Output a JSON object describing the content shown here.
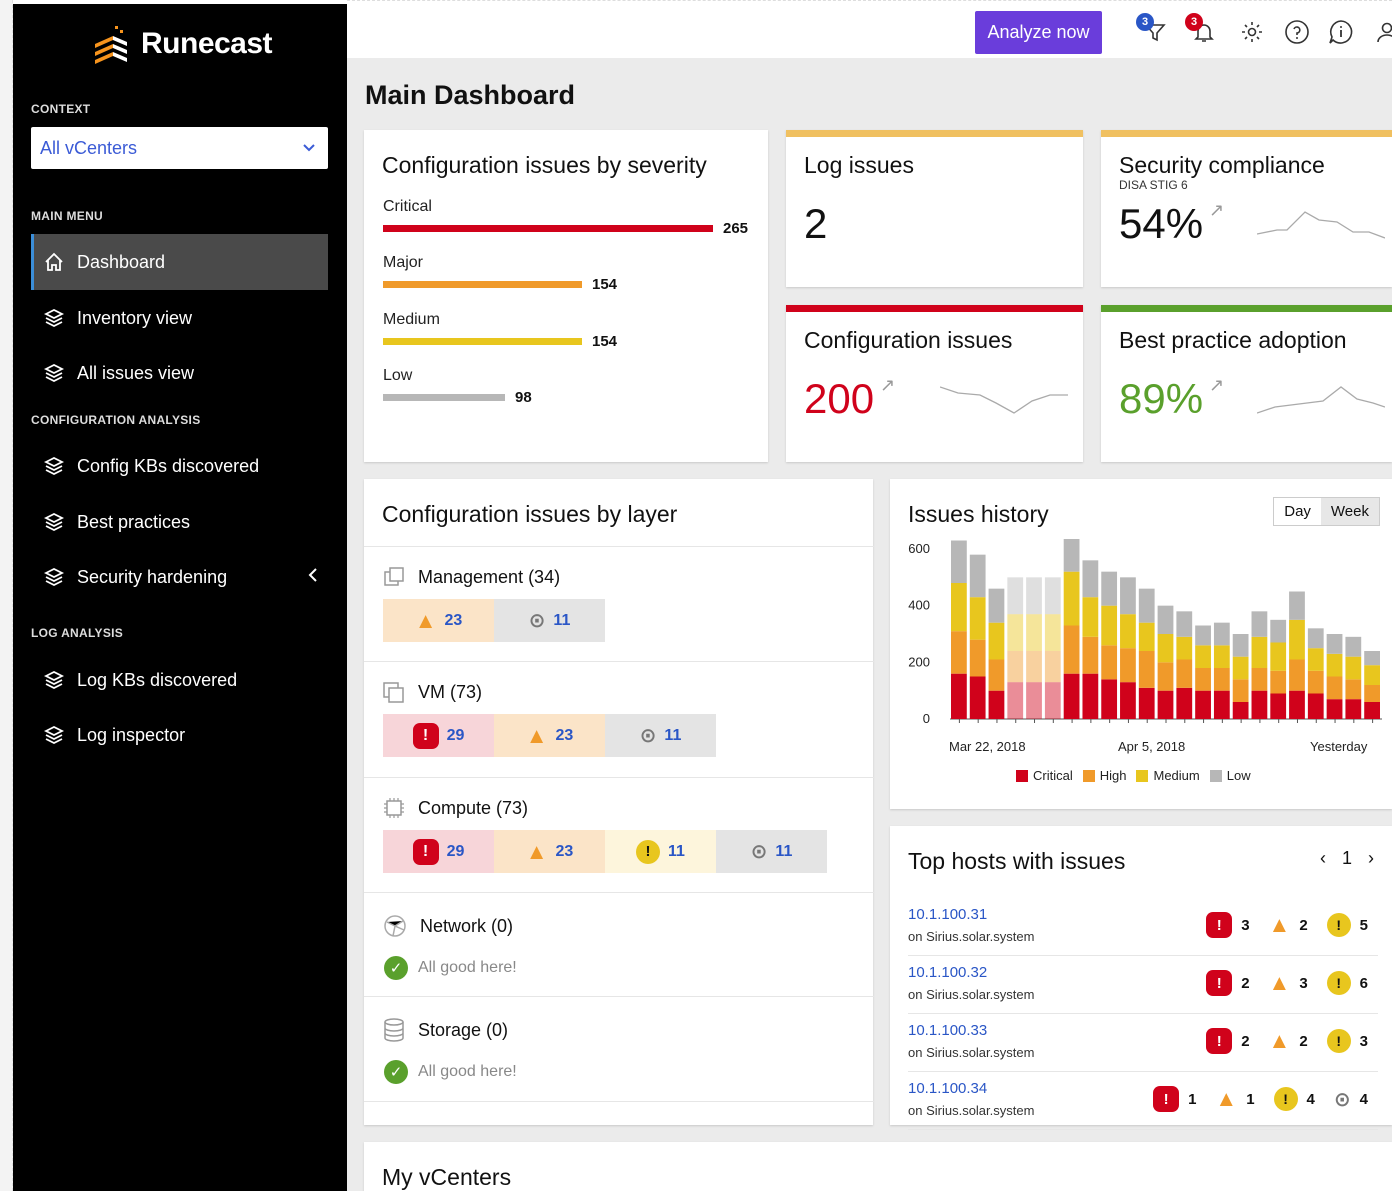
{
  "app": {
    "brand": "Runecast"
  },
  "sidebar": {
    "context_label": "CONTEXT",
    "context_value": "All vCenters",
    "main_menu_label": "MAIN MENU",
    "config_label": "CONFIGURATION ANALYSIS",
    "log_label": "LOG ANALYSIS",
    "items": [
      {
        "label": "Dashboard"
      },
      {
        "label": "Inventory view"
      },
      {
        "label": "All issues view"
      },
      {
        "label": "Config KBs discovered"
      },
      {
        "label": "Best practices"
      },
      {
        "label": "Security hardening"
      },
      {
        "label": "Log KBs discovered"
      },
      {
        "label": "Log inspector"
      }
    ]
  },
  "topbar": {
    "analyze_label": "Analyze now",
    "filter_badge": "3",
    "notif_badge": "3"
  },
  "page_title": "Main Dashboard",
  "severity_card": {
    "title": "Configuration issues by severity",
    "rows": [
      {
        "label": "Critical",
        "value": "265",
        "color": "#d0021b"
      },
      {
        "label": "Major",
        "value": "154",
        "color": "#f09a2a"
      },
      {
        "label": "Medium",
        "value": "154",
        "color": "#e8c61e"
      },
      {
        "label": "Low",
        "value": "98",
        "color": "#b7b7b7"
      }
    ]
  },
  "log_card": {
    "title": "Log issues",
    "value": "2",
    "accent": "#f0c060"
  },
  "security_card": {
    "title": "Security compliance",
    "subtitle": "DISA STIG 6",
    "value": "54%",
    "accent": "#f0c060"
  },
  "config_card": {
    "title": "Configuration issues",
    "value": "200",
    "accent": "#d0021b"
  },
  "bp_card": {
    "title": "Best practice adoption",
    "value": "89%",
    "accent": "#5aa02c"
  },
  "layer_card": {
    "title": "Configuration issues by layer",
    "sections": [
      {
        "name": "Management (34)",
        "chips": [
          "23",
          "11"
        ]
      },
      {
        "name": "VM (73)",
        "chips": [
          "29",
          "23",
          "11"
        ]
      },
      {
        "name": "Compute (73)",
        "chips": [
          "29",
          "23",
          "11",
          "11"
        ]
      },
      {
        "name": "Network (0)",
        "good": "All good here!"
      },
      {
        "name": "Storage (0)",
        "good": "All good here!"
      }
    ]
  },
  "history_card": {
    "title": "Issues history",
    "toggle": [
      "Day",
      "Week"
    ],
    "xlabels": [
      "Mar 22, 2018",
      "Apr 5, 2018",
      "Yesterday"
    ],
    "legend": [
      "Critical",
      "High",
      "Medium",
      "Low"
    ]
  },
  "chart_data": {
    "type": "bar",
    "stacked": true,
    "ylim": [
      0,
      600
    ],
    "yticks": [
      "600",
      "400",
      "200",
      "0"
    ],
    "colors": [
      "#d0021b",
      "#f09a2a",
      "#e8c61e",
      "#b7b7b7"
    ],
    "series": [
      {
        "name": "Critical",
        "values": [
          160,
          150,
          100,
          130,
          130,
          130,
          160,
          160,
          140,
          130,
          110,
          100,
          110,
          100,
          100,
          60,
          100,
          90,
          100,
          90,
          70,
          70,
          60
        ]
      },
      {
        "name": "High",
        "values": [
          150,
          130,
          110,
          110,
          110,
          110,
          170,
          130,
          120,
          120,
          130,
          100,
          100,
          80,
          80,
          80,
          80,
          80,
          110,
          80,
          80,
          70,
          60
        ]
      },
      {
        "name": "Medium",
        "values": [
          170,
          150,
          130,
          130,
          130,
          130,
          190,
          140,
          140,
          120,
          100,
          100,
          80,
          80,
          80,
          80,
          110,
          100,
          140,
          80,
          80,
          80,
          70
        ]
      },
      {
        "name": "Low",
        "values": [
          150,
          150,
          120,
          130,
          130,
          130,
          160,
          130,
          120,
          130,
          120,
          100,
          90,
          70,
          80,
          80,
          90,
          80,
          100,
          70,
          70,
          70,
          50
        ]
      }
    ]
  },
  "hosts_card": {
    "title": "Top hosts with issues",
    "page": "1",
    "rows": [
      {
        "ip": "10.1.100.31",
        "sub": "on Sirius.solar.system",
        "counts": [
          "3",
          "2",
          "5"
        ]
      },
      {
        "ip": "10.1.100.32",
        "sub": "on Sirius.solar.system",
        "counts": [
          "2",
          "3",
          "6"
        ]
      },
      {
        "ip": "10.1.100.33",
        "sub": "on Sirius.solar.system",
        "counts": [
          "2",
          "2",
          "3"
        ]
      },
      {
        "ip": "10.1.100.34",
        "sub": "on Sirius.solar.system",
        "counts": [
          "1",
          "1",
          "4",
          "4"
        ]
      }
    ]
  },
  "vcenters_card": {
    "title": "My vCenters"
  }
}
